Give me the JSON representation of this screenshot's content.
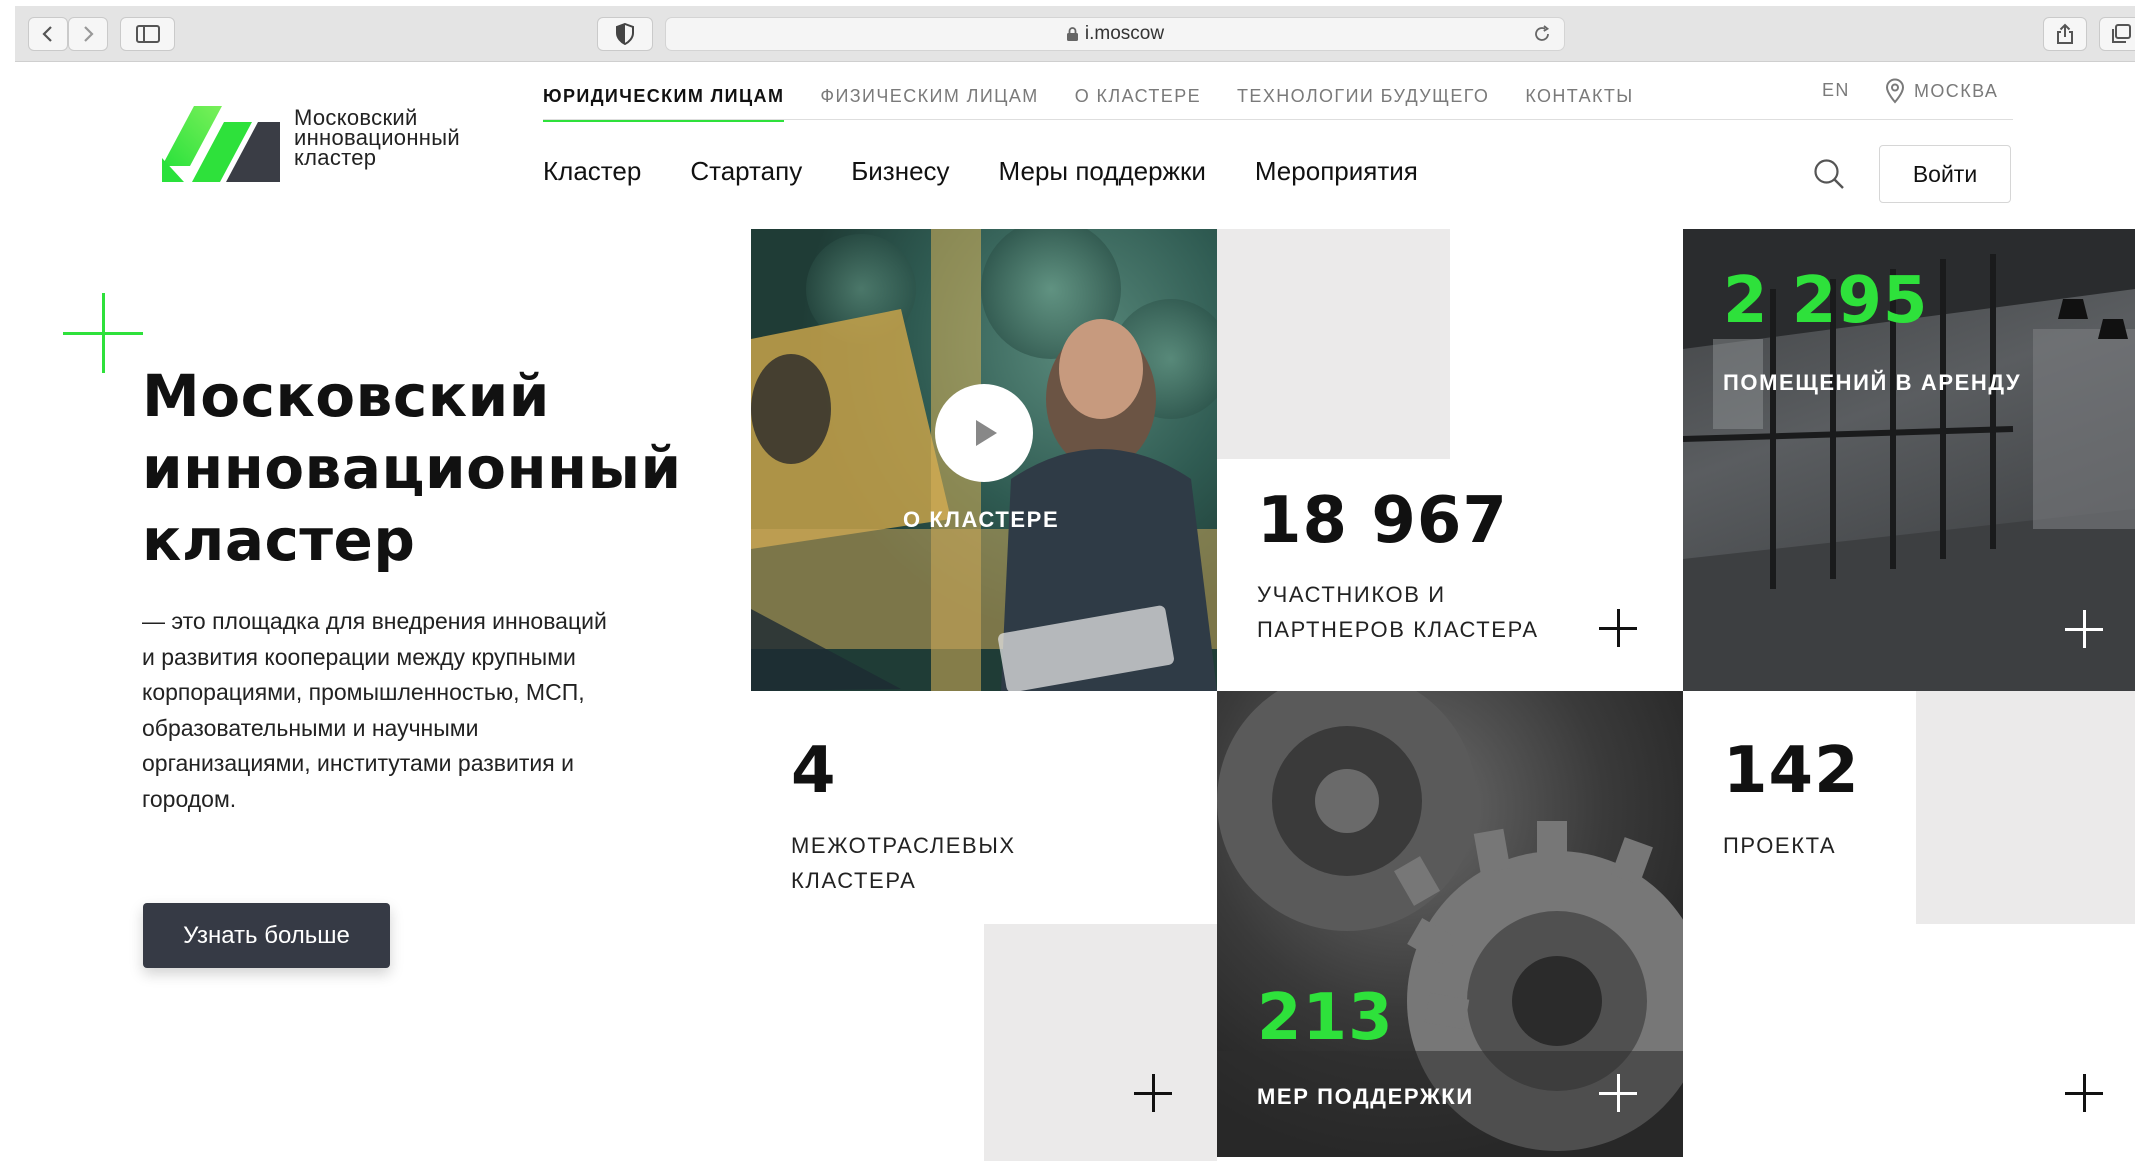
{
  "browser": {
    "url": "i.moscow"
  },
  "header": {
    "logo_lines": [
      "Московский",
      "инновационный",
      "кластер"
    ],
    "top_nav": [
      {
        "label": "ЮРИДИЧЕСКИМ ЛИЦАМ",
        "active": true
      },
      {
        "label": "ФИЗИЧЕСКИМ ЛИЦАМ",
        "active": false
      },
      {
        "label": "О КЛАСТЕРЕ",
        "active": false
      },
      {
        "label": "ТЕХНОЛОГИИ БУДУЩЕГО",
        "active": false
      },
      {
        "label": "КОНТАКТЫ",
        "active": false
      }
    ],
    "lang": "EN",
    "city": "МОСКВА",
    "main_nav": [
      "Кластер",
      "Стартапу",
      "Бизнесу",
      "Меры поддержки",
      "Мероприятия"
    ],
    "login_label": "Войти"
  },
  "hero": {
    "title_lines": [
      "Московский",
      "инновационный",
      "кластер"
    ],
    "description": "— это площадка для внедрения инноваций и развития кооперации между крупными корпорациями, промышленностью, МСП, образовательными и научными организациями, институтами развития и городом.",
    "button_label": "Узнать больше"
  },
  "tiles": {
    "video_label": "О КЛАСТЕРЕ",
    "participants": {
      "value": "18 967",
      "label_lines": [
        "УЧАСТНИКОВ И",
        "ПАРТНЕРОВ КЛАСТЕРА"
      ]
    },
    "rent": {
      "value": "2 295",
      "label": "ПОМЕЩЕНИЙ В АРЕНДУ"
    },
    "clusters": {
      "value": "4",
      "label_lines": [
        "МЕЖОТРАСЛЕВЫХ",
        "КЛАСТЕРА"
      ]
    },
    "support": {
      "value": "213",
      "label": "МЕР ПОДДЕРЖКИ"
    },
    "projects": {
      "value": "142",
      "label": "ПРОЕКТА"
    }
  },
  "colors": {
    "accent": "#2ee13b",
    "button_dark": "#363a45",
    "tile_grey": "#ebeaea"
  }
}
